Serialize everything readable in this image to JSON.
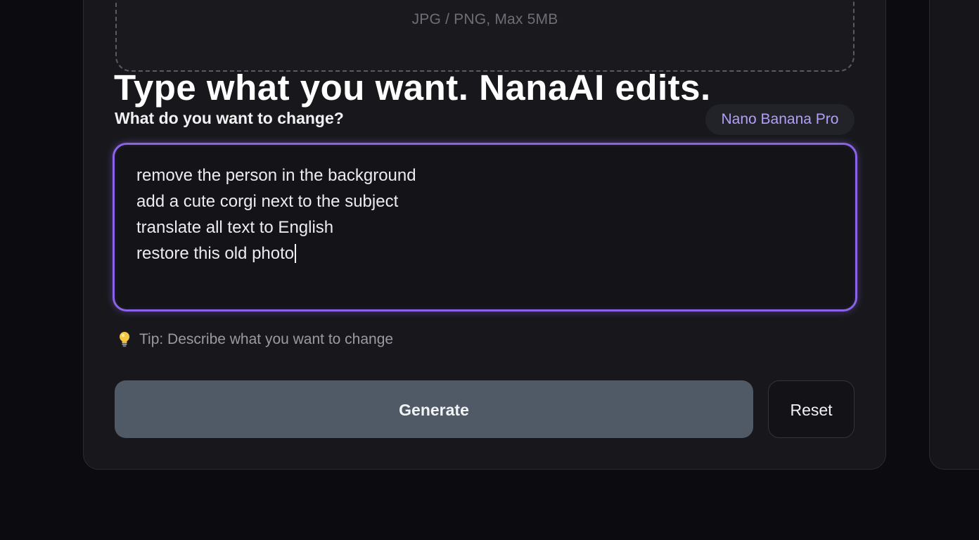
{
  "upload": {
    "hint": "JPG / PNG, Max 5MB"
  },
  "headline": "Type what you want. NanaAI edits.",
  "prompt": {
    "label": "What do you want to change?",
    "model_badge": "Nano Banana Pro",
    "lines": [
      "remove the person in the background",
      "add a cute corgi next to the subject",
      "translate all text to English",
      "restore this old photo"
    ]
  },
  "tip": {
    "icon": "lightbulb-icon",
    "text": "Tip: Describe what you want to change"
  },
  "actions": {
    "generate_label": "Generate",
    "reset_label": "Reset"
  },
  "colors": {
    "accent": "#8b63e6",
    "badge_text": "#b3a0f6",
    "generate_bg": "#505a66",
    "background": "#0c0c10",
    "card": "#18181c"
  }
}
